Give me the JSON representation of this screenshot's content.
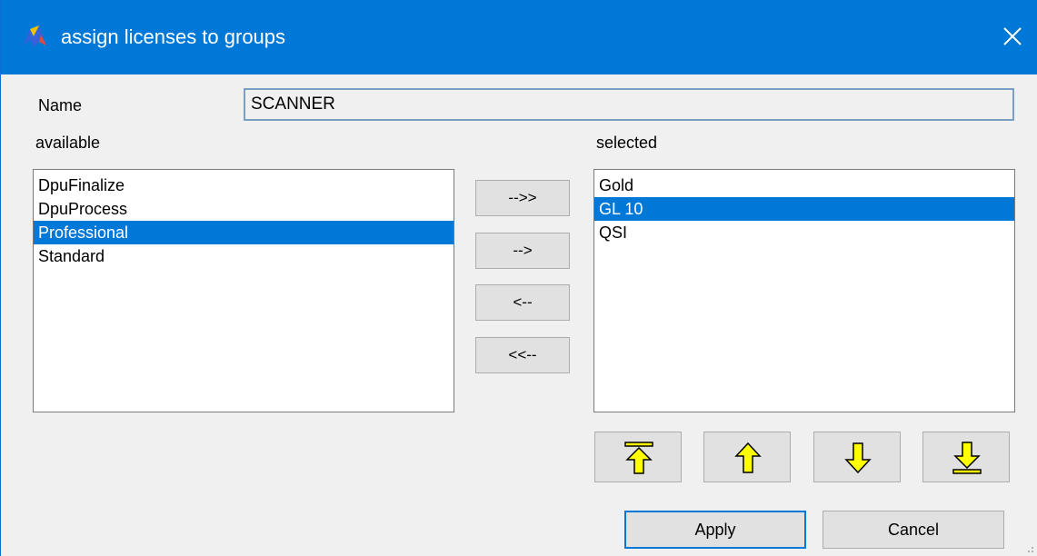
{
  "window": {
    "title": "assign licenses to groups",
    "app_icon": "app-logo-icon",
    "close_icon": "close-icon"
  },
  "form": {
    "name_label": "Name",
    "name_value": "SCANNER",
    "available_label": "available",
    "selected_label": "selected"
  },
  "available": {
    "items": [
      "DpuFinalize",
      "DpuProcess",
      "Professional",
      "Standard"
    ],
    "selected_item": "Professional"
  },
  "selected": {
    "items": [
      "Gold",
      "GL 10",
      "QSI"
    ],
    "selected_item": "GL 10"
  },
  "transfer_buttons": {
    "add_all": "-->>",
    "add_one": "-->",
    "remove_one": "<--",
    "remove_all": "<<--"
  },
  "order_buttons": {
    "top_icon": "move-to-top-icon",
    "up_icon": "move-up-icon",
    "down_icon": "move-down-icon",
    "bottom_icon": "move-to-bottom-icon",
    "arrow_color": "#ffff00"
  },
  "actions": {
    "apply": "Apply",
    "cancel": "Cancel"
  }
}
